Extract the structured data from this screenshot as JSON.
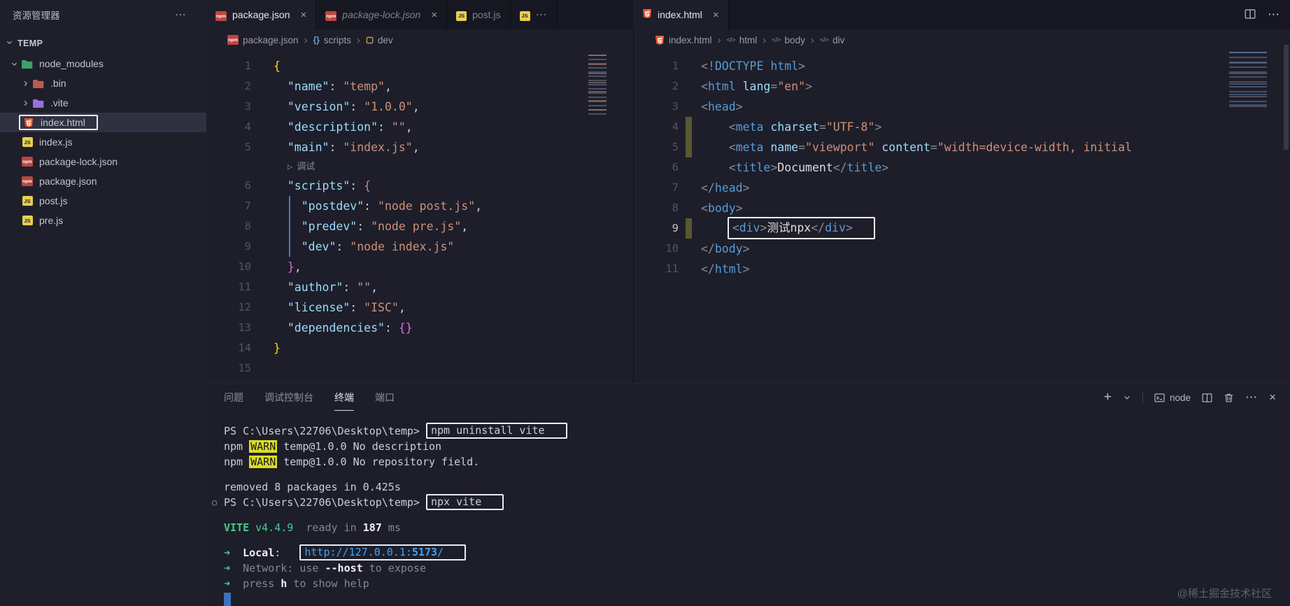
{
  "explorer": {
    "title": "资源管理器",
    "more_label": "⋯",
    "section": "TEMP",
    "items": [
      {
        "label": "node_modules",
        "icon": "folder-node",
        "folder": true,
        "expanded": true
      },
      {
        "label": ".bin",
        "icon": "folder-bin",
        "folder": true,
        "child": true
      },
      {
        "label": ".vite",
        "icon": "folder-vite",
        "folder": true,
        "child": true
      },
      {
        "label": "index.html",
        "icon": "html",
        "selected": true,
        "boxed": true
      },
      {
        "label": "index.js",
        "icon": "js"
      },
      {
        "label": "package-lock.json",
        "icon": "npm"
      },
      {
        "label": "package.json",
        "icon": "npm"
      },
      {
        "label": "post.js",
        "icon": "js"
      },
      {
        "label": "pre.js",
        "icon": "js"
      }
    ]
  },
  "tabs": {
    "group1": [
      {
        "label": "package.json",
        "icon": "npm",
        "active": true,
        "close": "×"
      },
      {
        "label": "package-lock.json",
        "icon": "npm",
        "italic": true,
        "close": "×"
      },
      {
        "label": "post.js",
        "icon": "js"
      },
      {
        "label": "⋯",
        "icon": "js",
        "overflow": true
      }
    ],
    "group2": [
      {
        "label": "index.html",
        "icon": "html",
        "active": true,
        "close": "×"
      }
    ]
  },
  "window_actions": {
    "more": "⋯"
  },
  "breadcrumbs": {
    "left": [
      {
        "label": "package.json",
        "icon": "npm"
      },
      {
        "label": "scripts",
        "icon": "braces"
      },
      {
        "label": "dev",
        "icon": "symbol"
      }
    ],
    "right": [
      {
        "label": "index.html",
        "icon": "html"
      },
      {
        "label": "html",
        "icon": "tag"
      },
      {
        "label": "body",
        "icon": "tag"
      },
      {
        "label": "div",
        "icon": "tag"
      }
    ]
  },
  "editor_left": {
    "lines": [
      {
        "n": "1",
        "s": [
          [
            "b1",
            "{"
          ]
        ]
      },
      {
        "n": "2",
        "s": [
          [
            "p",
            "  "
          ],
          [
            "k",
            "\"name\""
          ],
          [
            "p",
            ": "
          ],
          [
            "s",
            "\"temp\""
          ],
          [
            "p",
            ","
          ]
        ]
      },
      {
        "n": "3",
        "s": [
          [
            "p",
            "  "
          ],
          [
            "k",
            "\"version\""
          ],
          [
            "p",
            ": "
          ],
          [
            "s",
            "\"1.0.0\""
          ],
          [
            "p",
            ","
          ]
        ]
      },
      {
        "n": "4",
        "s": [
          [
            "p",
            "  "
          ],
          [
            "k",
            "\"description\""
          ],
          [
            "p",
            ": "
          ],
          [
            "s",
            "\"\""
          ],
          [
            "p",
            ","
          ]
        ]
      },
      {
        "n": "5",
        "s": [
          [
            "p",
            "  "
          ],
          [
            "k",
            "\"main\""
          ],
          [
            "p",
            ": "
          ],
          [
            "s",
            "\"index.js\""
          ],
          [
            "p",
            ","
          ]
        ]
      },
      {
        "lens": true,
        "text": "调试"
      },
      {
        "n": "6",
        "s": [
          [
            "p",
            "  "
          ],
          [
            "k",
            "\"scripts\""
          ],
          [
            "p",
            ": "
          ],
          [
            "b2",
            "{"
          ]
        ]
      },
      {
        "n": "7",
        "guide": true,
        "s": [
          [
            "p",
            "    "
          ],
          [
            "k",
            "\"postdev\""
          ],
          [
            "p",
            ": "
          ],
          [
            "s",
            "\"node post.js\""
          ],
          [
            "p",
            ","
          ]
        ]
      },
      {
        "n": "8",
        "guide": true,
        "s": [
          [
            "p",
            "    "
          ],
          [
            "k",
            "\"predev\""
          ],
          [
            "p",
            ": "
          ],
          [
            "s",
            "\"node pre.js\""
          ],
          [
            "p",
            ","
          ]
        ]
      },
      {
        "n": "9",
        "guide": true,
        "s": [
          [
            "p",
            "    "
          ],
          [
            "k",
            "\"dev\""
          ],
          [
            "p",
            ": "
          ],
          [
            "s",
            "\"node index.js\""
          ]
        ]
      },
      {
        "n": "10",
        "s": [
          [
            "p",
            "  "
          ],
          [
            "b2",
            "}"
          ],
          [
            "p",
            ","
          ]
        ]
      },
      {
        "n": "11",
        "s": [
          [
            "p",
            "  "
          ],
          [
            "k",
            "\"author\""
          ],
          [
            "p",
            ": "
          ],
          [
            "s",
            "\"\""
          ],
          [
            "p",
            ","
          ]
        ]
      },
      {
        "n": "12",
        "s": [
          [
            "p",
            "  "
          ],
          [
            "k",
            "\"license\""
          ],
          [
            "p",
            ": "
          ],
          [
            "s",
            "\"ISC\""
          ],
          [
            "p",
            ","
          ]
        ]
      },
      {
        "n": "13",
        "s": [
          [
            "p",
            "  "
          ],
          [
            "k",
            "\"dependencies\""
          ],
          [
            "p",
            ": "
          ],
          [
            "b2",
            "{}"
          ]
        ]
      },
      {
        "n": "14",
        "s": [
          [
            "b1",
            "}"
          ]
        ]
      },
      {
        "n": "15",
        "s": []
      }
    ]
  },
  "editor_right": {
    "lines": [
      {
        "n": "1",
        "s": [
          [
            "a",
            "<!"
          ],
          [
            "t",
            "DOCTYPE html"
          ],
          [
            "a",
            ">"
          ]
        ]
      },
      {
        "n": "2",
        "s": [
          [
            "a",
            "<"
          ],
          [
            "t",
            "html"
          ],
          [
            "p",
            " "
          ],
          [
            "at",
            "lang"
          ],
          [
            "a",
            "="
          ],
          [
            "s",
            "\"en\""
          ],
          [
            "a",
            ">"
          ]
        ]
      },
      {
        "n": "3",
        "s": [
          [
            "a",
            "<"
          ],
          [
            "t",
            "head"
          ],
          [
            "a",
            ">"
          ]
        ]
      },
      {
        "n": "4",
        "mod": true,
        "s": [
          [
            "p",
            "    "
          ],
          [
            "a",
            "<"
          ],
          [
            "t",
            "meta"
          ],
          [
            "p",
            " "
          ],
          [
            "at",
            "charset"
          ],
          [
            "a",
            "="
          ],
          [
            "s",
            "\"UTF-8\""
          ],
          [
            "a",
            ">"
          ]
        ]
      },
      {
        "n": "5",
        "mod": true,
        "s": [
          [
            "p",
            "    "
          ],
          [
            "a",
            "<"
          ],
          [
            "t",
            "meta"
          ],
          [
            "p",
            " "
          ],
          [
            "at",
            "name"
          ],
          [
            "a",
            "="
          ],
          [
            "s",
            "\"viewport\""
          ],
          [
            "p",
            " "
          ],
          [
            "at",
            "content"
          ],
          [
            "a",
            "="
          ],
          [
            "s",
            "\"width=device-width, initial"
          ]
        ]
      },
      {
        "n": "6",
        "s": [
          [
            "p",
            "    "
          ],
          [
            "a",
            "<"
          ],
          [
            "t",
            "title"
          ],
          [
            "a",
            ">"
          ],
          [
            "x",
            "Document"
          ],
          [
            "a",
            "</"
          ],
          [
            "t",
            "title"
          ],
          [
            "a",
            ">"
          ]
        ]
      },
      {
        "n": "7",
        "s": [
          [
            "a",
            "</"
          ],
          [
            "t",
            "head"
          ],
          [
            "a",
            ">"
          ]
        ]
      },
      {
        "n": "8",
        "s": [
          [
            "a",
            "<"
          ],
          [
            "t",
            "body"
          ],
          [
            "a",
            ">"
          ]
        ]
      },
      {
        "n": "9",
        "mod": true,
        "cur": true,
        "s": [
          [
            "p",
            "    "
          ],
          {
            "box": [
              [
                "a",
                "<"
              ],
              [
                "t",
                "div"
              ],
              [
                "a",
                ">"
              ],
              [
                "x",
                "测试npx"
              ],
              [
                "a",
                "</"
              ],
              [
                "t",
                "div"
              ],
              [
                "a",
                ">"
              ]
            ]
          }
        ]
      },
      {
        "n": "10",
        "s": [
          [
            "a",
            "</"
          ],
          [
            "t",
            "body"
          ],
          [
            "a",
            ">"
          ]
        ]
      },
      {
        "n": "11",
        "s": [
          [
            "a",
            "</"
          ],
          [
            "t",
            "html"
          ],
          [
            "a",
            ">"
          ]
        ]
      }
    ]
  },
  "panel": {
    "tabs": [
      {
        "name": "problems",
        "label": "问题"
      },
      {
        "name": "debug-console",
        "label": "调试控制台"
      },
      {
        "name": "terminal",
        "label": "终端",
        "active": true
      },
      {
        "name": "ports",
        "label": "端口"
      }
    ],
    "profile": "node",
    "actions": {
      "new_terminal": "+",
      "more": "⋯",
      "kill": "×"
    },
    "terminal": [
      {
        "s": [
          [
            "d",
            "PS C:\\Users\\22706\\Desktop\\temp> "
          ],
          {
            "box": [
              [
                "d",
                "npm uninstall vite"
              ]
            ]
          }
        ]
      },
      {
        "s": [
          [
            "d",
            "npm "
          ],
          [
            "w",
            "WARN"
          ],
          [
            "d",
            " temp@1.0.0 No description"
          ]
        ]
      },
      {
        "s": [
          [
            "d",
            "npm "
          ],
          [
            "w",
            "WARN"
          ],
          [
            "d",
            " temp@1.0.0 No repository field."
          ]
        ]
      },
      {
        "blank": true
      },
      {
        "s": [
          [
            "d",
            "removed 8 packages in 0.425s"
          ]
        ]
      },
      {
        "s": [
          [
            "mk",
            "○"
          ],
          [
            "d",
            "PS C:\\Users\\22706\\Desktop\\temp> "
          ],
          {
            "box": [
              [
                "d",
                "npx vite"
              ]
            ]
          }
        ]
      },
      {
        "blank": true
      },
      {
        "s": [
          [
            "gb",
            "VITE"
          ],
          [
            "g",
            " v4.4.9"
          ],
          [
            "m",
            "  ready in "
          ],
          [
            "b",
            "187"
          ],
          [
            "m",
            " ms"
          ]
        ]
      },
      {
        "blank": true
      },
      {
        "s": [
          [
            "g",
            "➜"
          ],
          [
            "d",
            "  "
          ],
          [
            "b",
            "Local"
          ],
          [
            "d",
            ":   "
          ],
          {
            "box": [
              [
                "c",
                "http://127.0.0.1:"
              ],
              [
                "cb",
                "5173"
              ],
              [
                "c",
                "/"
              ]
            ]
          }
        ]
      },
      {
        "s": [
          [
            "g",
            "➜"
          ],
          [
            "m",
            "  Network: use "
          ],
          [
            "b",
            "--host"
          ],
          [
            "m",
            " to expose"
          ]
        ]
      },
      {
        "s": [
          [
            "g",
            "➜"
          ],
          [
            "m",
            "  press "
          ],
          [
            "b",
            "h"
          ],
          [
            "m",
            " to show help"
          ]
        ]
      },
      {
        "cursor": true
      }
    ]
  },
  "watermark": "@稀土掘金技术社区"
}
